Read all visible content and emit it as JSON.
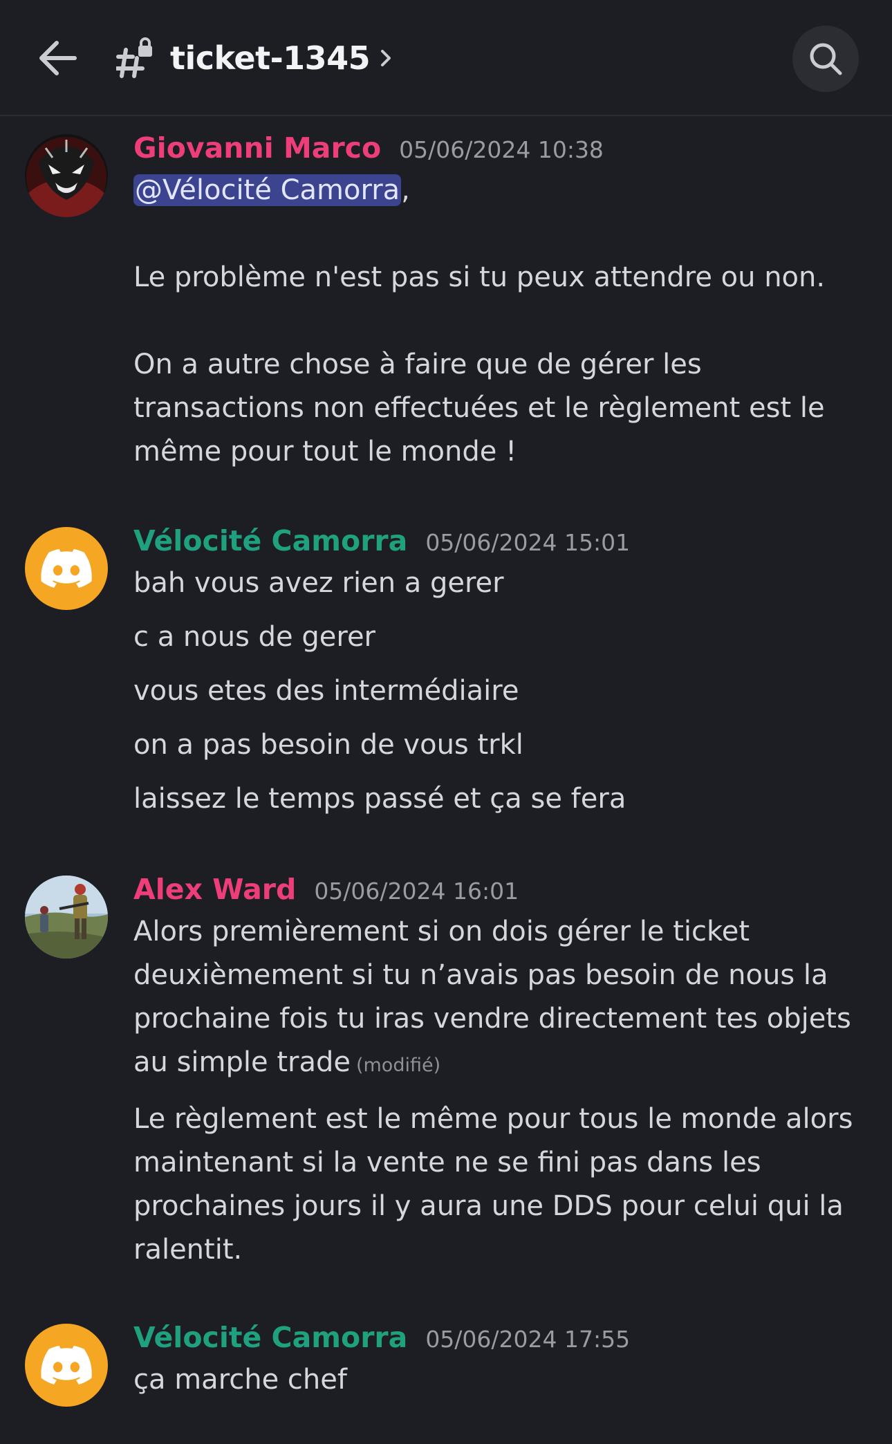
{
  "header": {
    "back_icon": "arrow-left-icon",
    "channel_icon": "thread-lock-icon",
    "channel_name": "ticket-1345",
    "chevron_icon": "chevron-right-icon",
    "search_icon": "search-icon"
  },
  "colors": {
    "background": "#1d1e23",
    "pink_user": "#ee3e7a",
    "teal_user": "#1fa07e",
    "mention_bg": "#3c4490",
    "discord_orange": "#f5a623"
  },
  "messages": [
    {
      "author": "Giovanni Marco",
      "timestamp": "05/06/2024 10:38",
      "mention": "@Vélocité Camorra",
      "mention_suffix": ",",
      "lines": [
        "Le problème n'est pas si tu peux attendre ou non.",
        "On a autre chose à faire que de gérer les",
        "transactions non effectuées et le règlement est le",
        "même pour tout le monde !"
      ]
    },
    {
      "author": "Vélocité Camorra",
      "timestamp": "05/06/2024 15:01",
      "lines": [
        "bah vous avez rien a gerer",
        "c a nous de gerer",
        "vous etes des intermédiaire",
        "on a pas besoin de vous trkl",
        "laissez le temps passé et ça se fera"
      ]
    },
    {
      "author": "Alex Ward",
      "timestamp": "05/06/2024 16:01",
      "lines": [
        "Alors premièrement si on dois gérer le ticket",
        "deuxièmement si tu n’avais pas besoin de nous la",
        "prochaine fois tu iras vendre directement tes objets",
        "au simple trade",
        "Le règlement est le même pour tous le monde alors",
        "maintenant si la vente ne se fini pas dans les",
        "prochaines jours il y aura une DDS pour celui qui la",
        "ralentit."
      ],
      "edited_label": "(modifié)"
    },
    {
      "author": "Vélocité Camorra",
      "timestamp": "05/06/2024 17:55",
      "lines": [
        "ça marche chef"
      ]
    }
  ]
}
